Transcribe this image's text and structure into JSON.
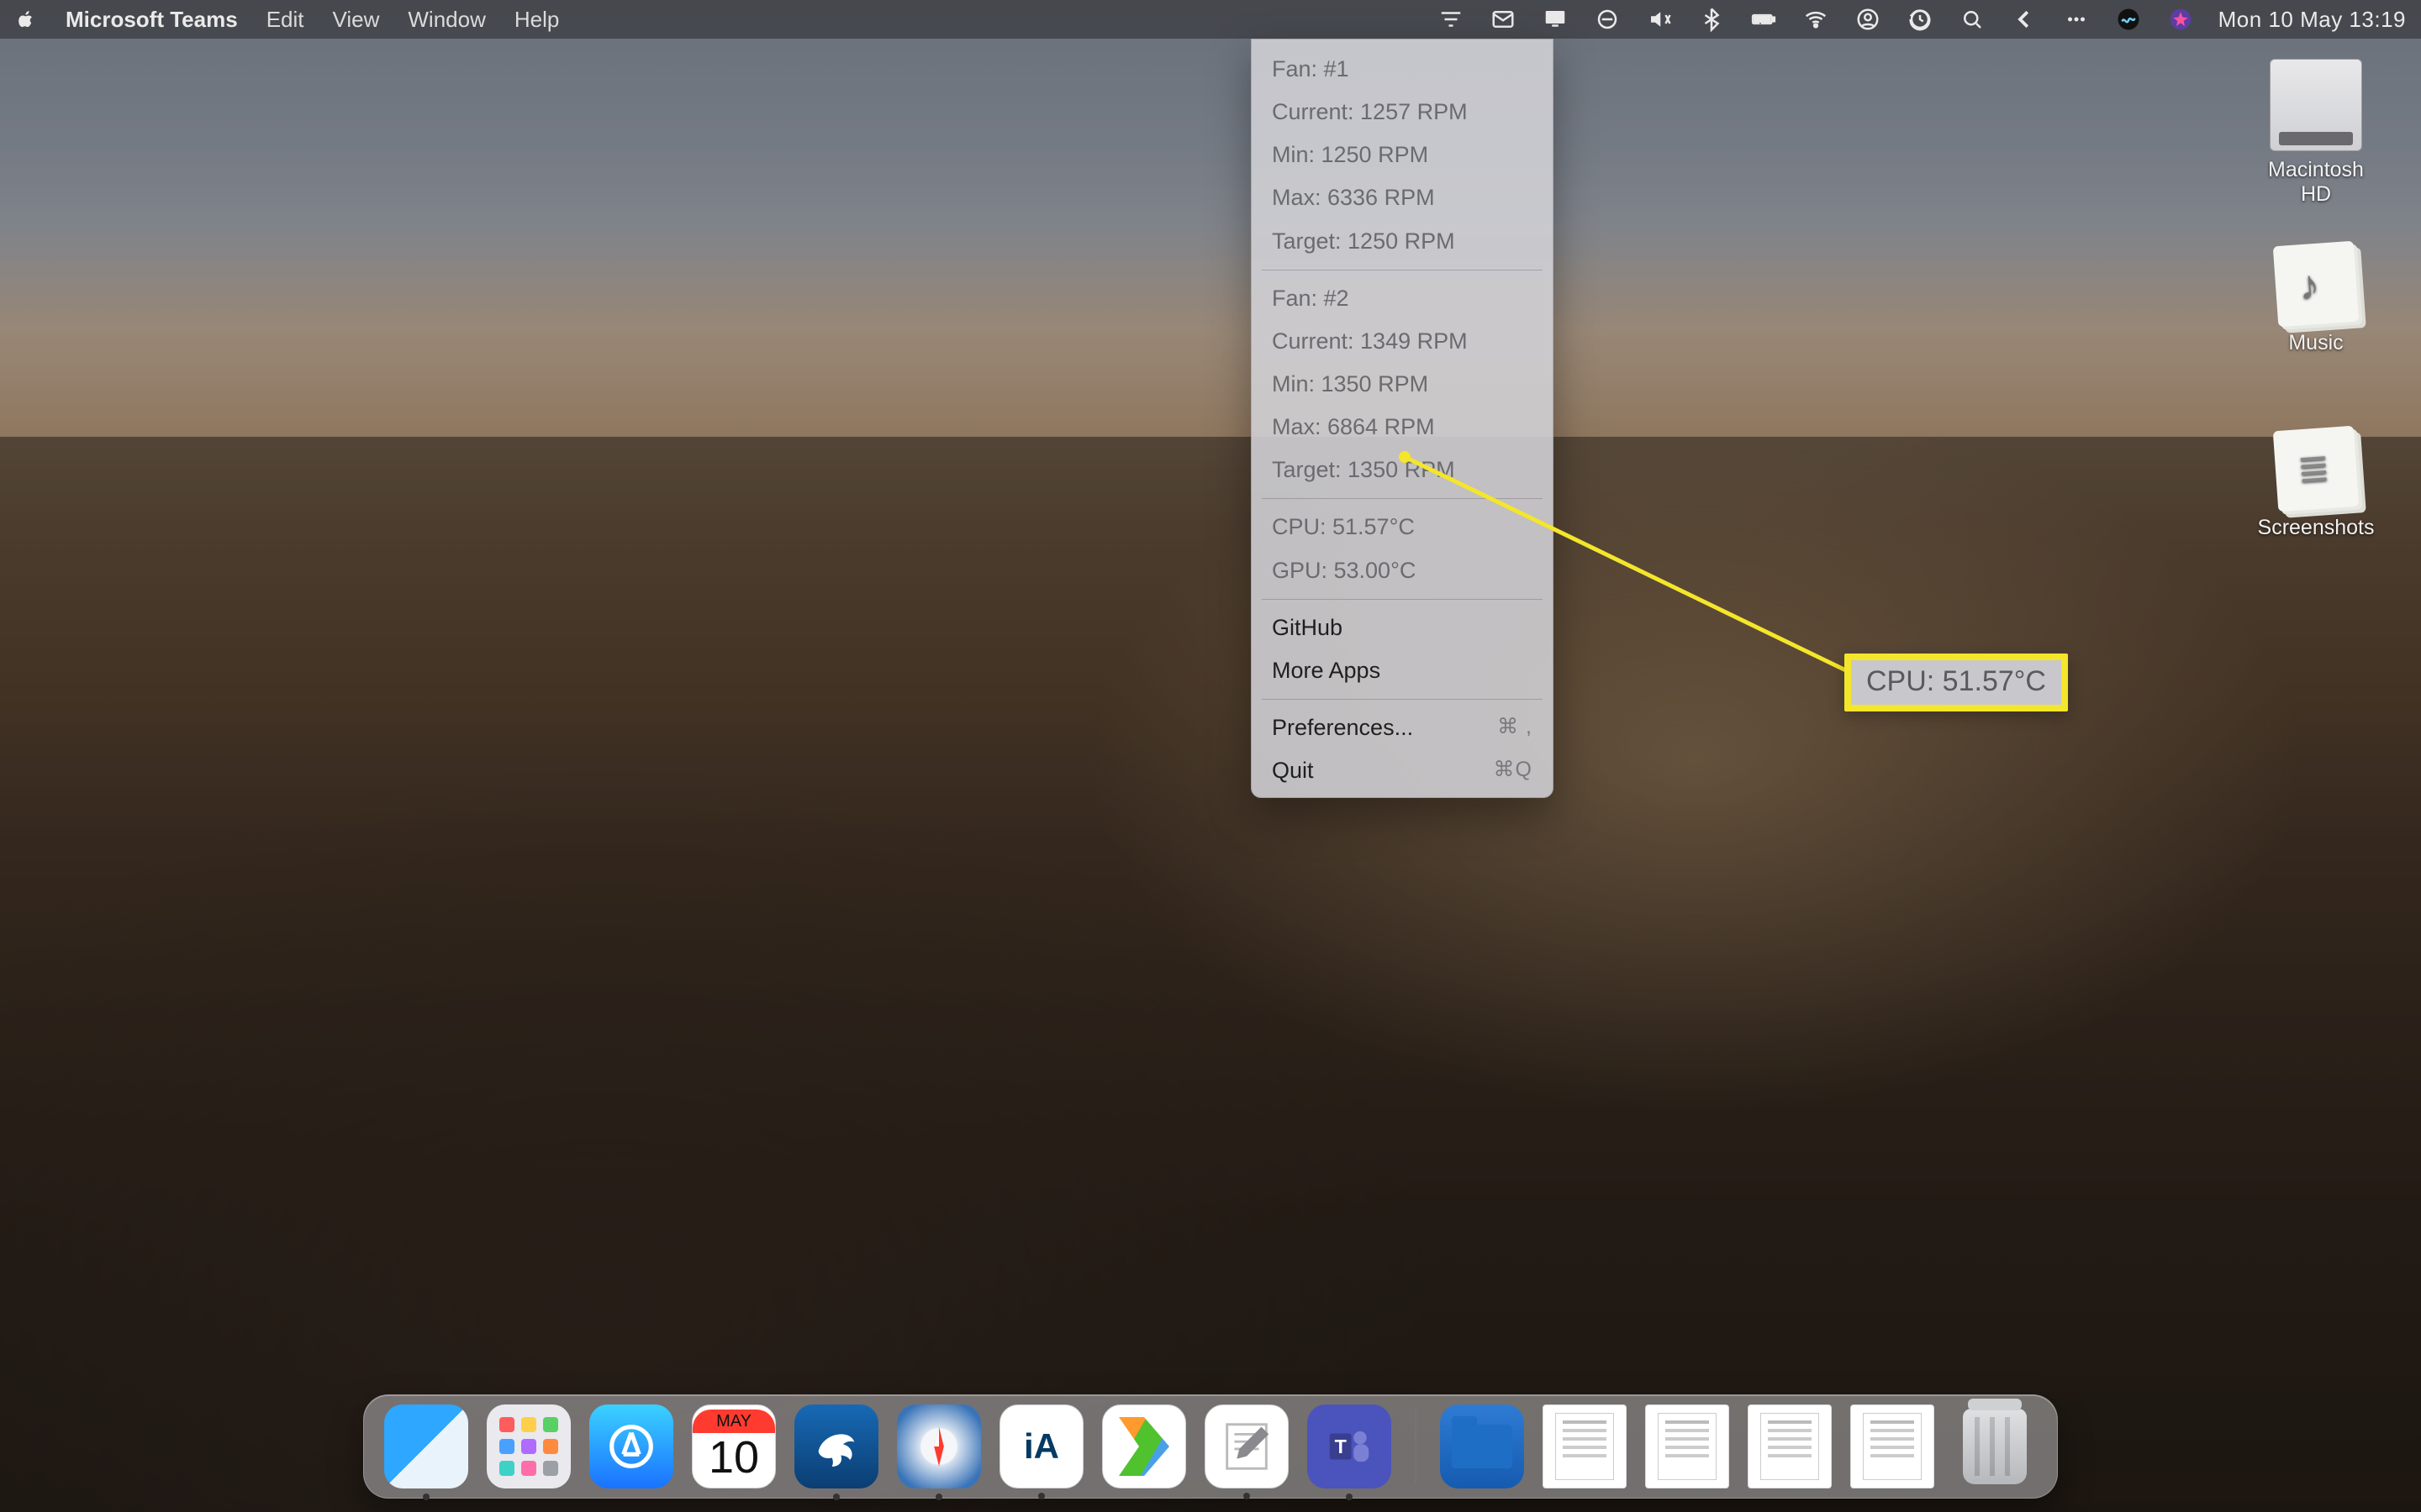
{
  "menubar": {
    "app_name": "Microsoft Teams",
    "items": [
      "Edit",
      "View",
      "Window",
      "Help"
    ],
    "clock": "Mon 10 May  13:19"
  },
  "dropdown": {
    "fan1": {
      "title": "Fan: #1",
      "current": "Current: 1257 RPM",
      "min": "Min: 1250 RPM",
      "max": "Max: 6336 RPM",
      "target": "Target: 1250 RPM"
    },
    "fan2": {
      "title": "Fan: #2",
      "current": "Current: 1349 RPM",
      "min": "Min: 1350 RPM",
      "max": "Max: 6864 RPM",
      "target": "Target: 1350 RPM"
    },
    "cpu": "CPU: 51.57°C",
    "gpu": "GPU: 53.00°C",
    "github": "GitHub",
    "more": "More Apps",
    "prefs": "Preferences...",
    "prefs_shortcut": "⌘ ,",
    "quit": "Quit",
    "quit_shortcut": "⌘Q"
  },
  "callout": {
    "text": "CPU: 51.57°C"
  },
  "desktop": {
    "hd": "Macintosh HD",
    "music": "Music",
    "screenshots": "Screenshots"
  },
  "dock": {
    "cal_month": "MAY",
    "cal_day": "10",
    "ia_label": "iA"
  }
}
